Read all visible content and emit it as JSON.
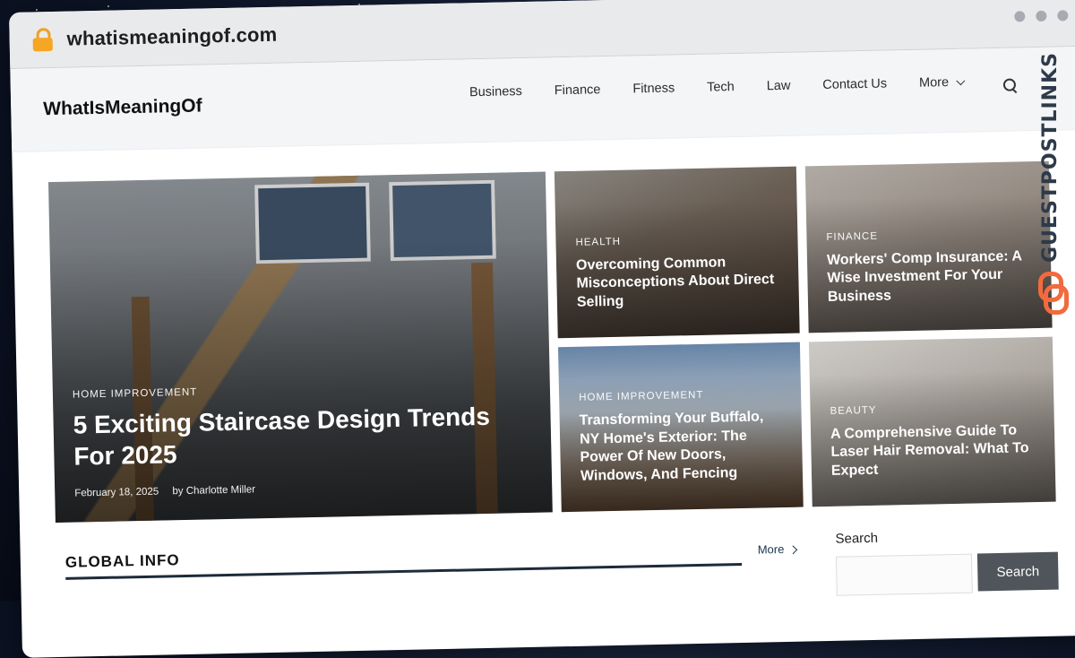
{
  "browser": {
    "url": "whatismeaningof.com"
  },
  "site": {
    "logo": "WhatIsMeaningOf",
    "nav": {
      "items": [
        "Business",
        "Finance",
        "Fitness",
        "Tech",
        "Law",
        "Contact Us"
      ],
      "more_label": "More"
    }
  },
  "featured": {
    "main": {
      "category": "Home Improvement",
      "title": "5 Exciting Staircase Design Trends For 2025",
      "date": "February 18, 2025",
      "author": "by Charlotte Miller"
    },
    "cards": [
      {
        "category": "Health",
        "title": "Overcoming Common Misconceptions About Direct Selling"
      },
      {
        "category": "Finance",
        "title": "Workers' Comp Insurance: A Wise Investment For Your Business"
      },
      {
        "category": "Home Improvement",
        "title": "Transforming Your Buffalo, NY Home's Exterior: The Power Of New Doors, Windows, And Fencing"
      },
      {
        "category": "Beauty",
        "title": "A Comprehensive Guide To Laser Hair Removal: What To Expect"
      }
    ]
  },
  "global_info": {
    "heading": "GLOBAL INFO",
    "more_label": "More"
  },
  "sidebar": {
    "search_label": "Search",
    "search_button": "Search"
  },
  "watermark": {
    "text": "GUESTPOSTLINKS"
  }
}
